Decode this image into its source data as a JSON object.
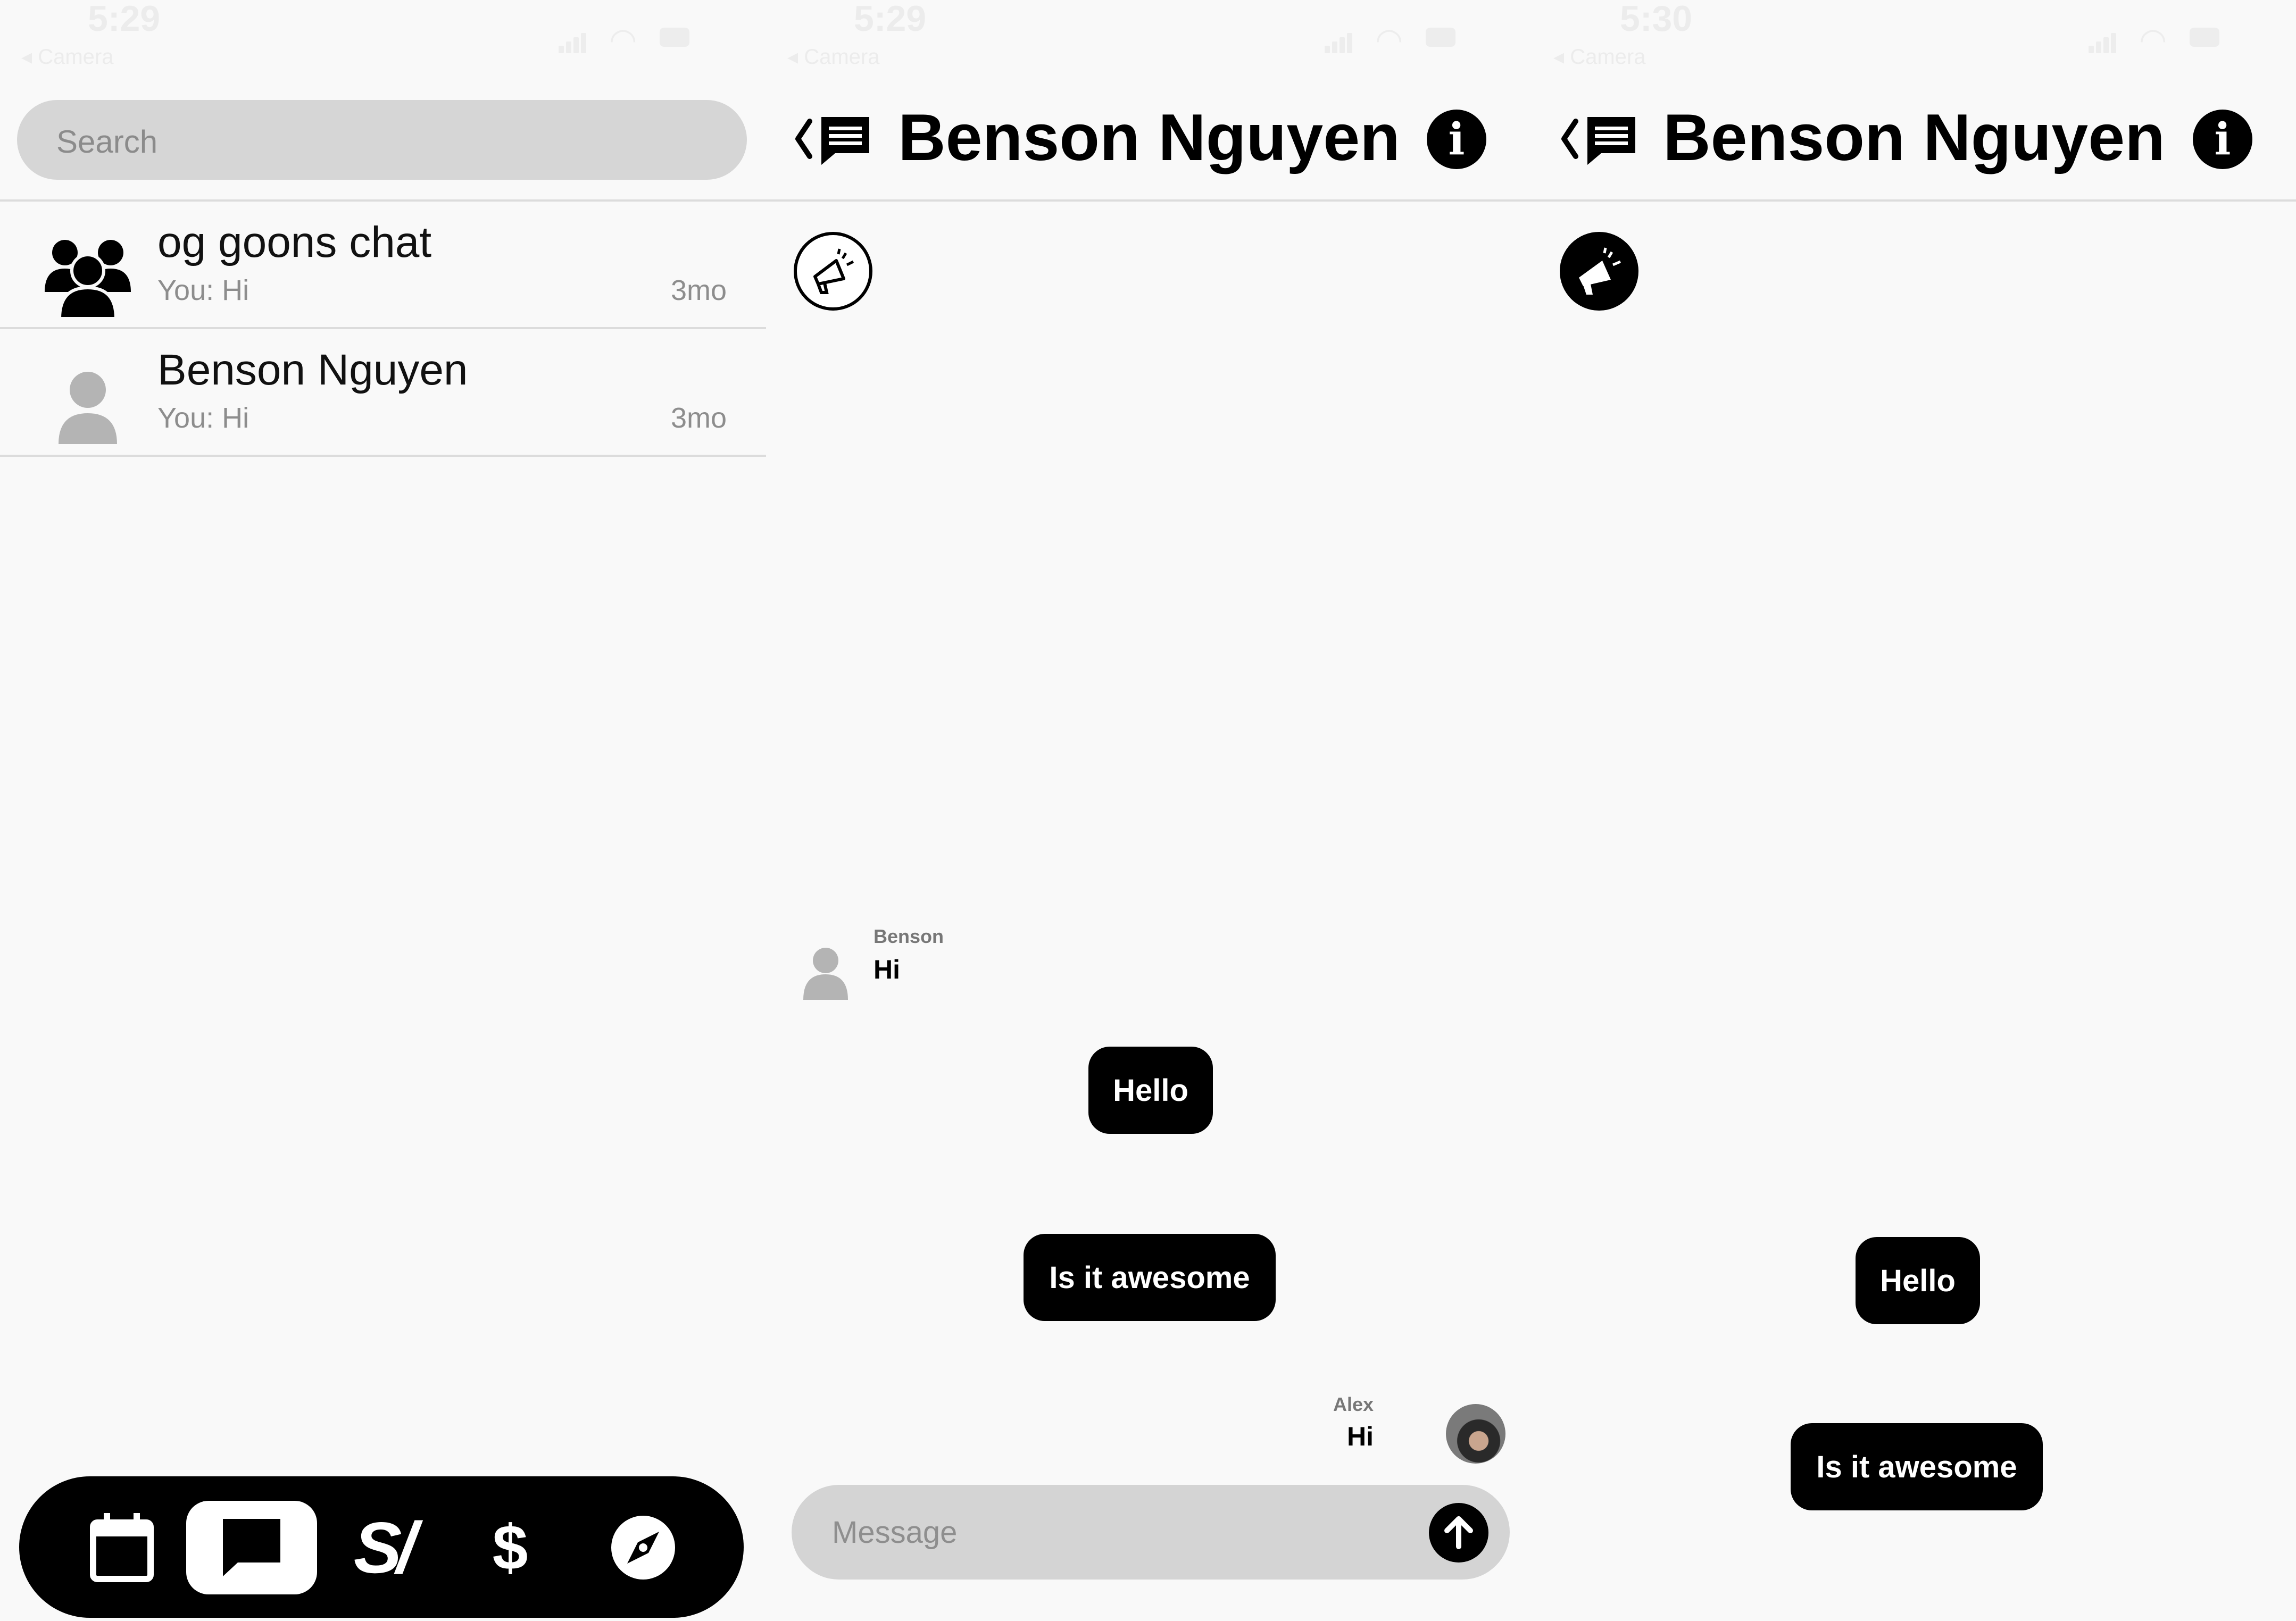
{
  "screens": [
    {
      "status": {
        "time": "5:29",
        "back_app": "◂ Camera"
      },
      "search_placeholder": "Search",
      "conversations": [
        {
          "name": "og goons chat",
          "preview": "You: Hi",
          "time": "3mo",
          "avatar": "group-icon"
        },
        {
          "name": "Benson Nguyen",
          "preview": "You: Hi",
          "time": "3mo",
          "avatar": "person-icon"
        }
      ],
      "tabbar": [
        {
          "icon": "calendar-icon",
          "active": false
        },
        {
          "icon": "chat-icon",
          "active": true
        },
        {
          "label": "S/",
          "icon": "slash-logo-icon",
          "active": false
        },
        {
          "label": "$",
          "icon": "dollar-icon",
          "active": false
        },
        {
          "icon": "compass-icon",
          "active": false
        }
      ]
    },
    {
      "status": {
        "time": "5:29",
        "back_app": "◂ Camera"
      },
      "title": "Benson Nguyen",
      "info_label": "i",
      "megaphone_state": "outline",
      "messages": [
        {
          "sender": "Benson",
          "text": "Hi"
        },
        {
          "bubble": "Hello"
        },
        {
          "bubble": "Is it awesome"
        },
        {
          "sender": "Alex",
          "text": "Hi"
        }
      ],
      "message_placeholder": "Message"
    },
    {
      "status": {
        "time": "5:30",
        "back_app": "◂ Camera"
      },
      "title": "Benson Nguyen",
      "info_label": "i",
      "megaphone_state": "filled",
      "bubbles": [
        "Hello",
        "Is it awesome"
      ]
    }
  ],
  "colors": {
    "background": "#f9f9f9",
    "accent": "#000000",
    "field": "#d6d6d6",
    "muted_text": "#8d8d8d"
  }
}
